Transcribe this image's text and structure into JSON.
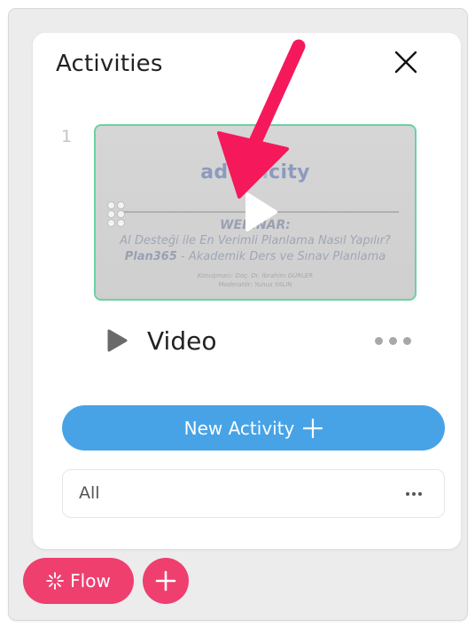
{
  "panel": {
    "title": "Activities",
    "close_icon": "close-icon"
  },
  "activities": [
    {
      "index": "1",
      "type_label": "Video",
      "thumbnail": {
        "brand_start": "adva",
        "brand_mid": "n",
        "brand_end": "city",
        "heading": "WEBINAR:",
        "line1": "AI Desteği ile En Verimli Planlama Nasıl Yapılır?",
        "line2_bold": "Plan365",
        "line2_rest": " - Akademik Ders ve Sınav Planlama",
        "speaker": "Konuşmacı: Doç. Dr. İbrahim GÜRLER",
        "moderator": "Moderatör: Yunus YALIN"
      }
    }
  ],
  "new_activity_label": "New Activity",
  "filter": {
    "value": "All"
  },
  "bottom_bar": {
    "flow_label": "Flow"
  },
  "colors": {
    "accent_blue": "#47a3e6",
    "accent_pink": "#ee3f6f",
    "thumb_border": "#6cd1a3",
    "annotation_arrow": "#f5195b"
  },
  "icons": [
    "close-icon",
    "play-icon",
    "video-icon",
    "more-icon",
    "plus-icon",
    "sparkle-icon",
    "drag-handle-icon",
    "arrow-annotation-icon"
  ]
}
